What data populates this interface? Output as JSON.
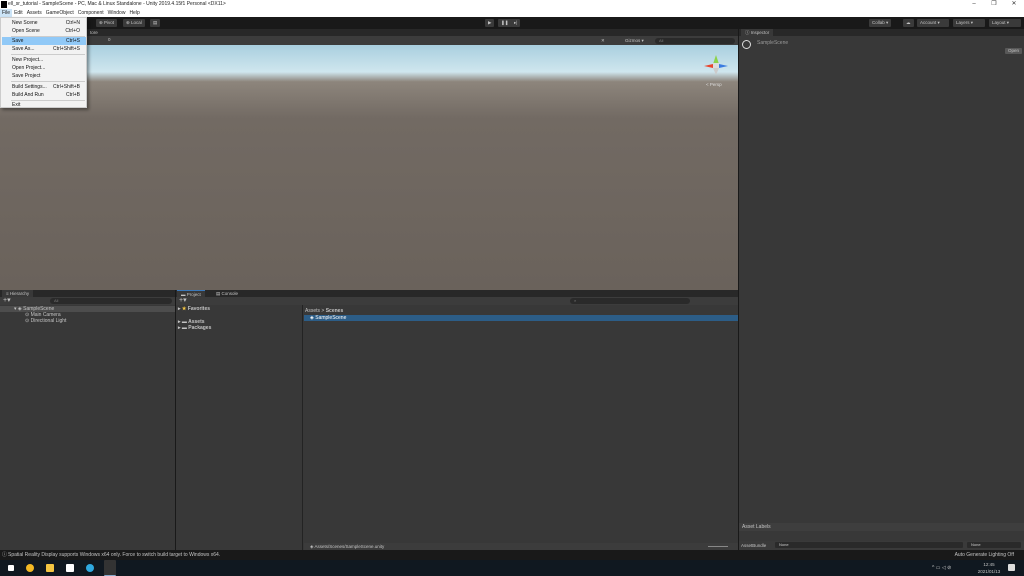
{
  "window": {
    "title": "ell_sr_tutorial - SampleScene - PC, Mac & Linux Standalone - Unity 2019.4.15f1 Personal <DX11>"
  },
  "menubar": [
    "File",
    "Edit",
    "Assets",
    "GameObject",
    "Component",
    "Window",
    "Help"
  ],
  "file_menu": [
    {
      "label": "New Scene",
      "shortcut": "Ctrl+N"
    },
    {
      "label": "Open Scene",
      "shortcut": "Ctrl+O"
    },
    {
      "label": "Save",
      "shortcut": "Ctrl+S",
      "highlighted": true
    },
    {
      "label": "Save As...",
      "shortcut": "Ctrl+Shift+S"
    },
    {
      "label": "New Project...",
      "shortcut": ""
    },
    {
      "label": "Open Project...",
      "shortcut": ""
    },
    {
      "label": "Save Project",
      "shortcut": ""
    },
    {
      "label": "Build Settings...",
      "shortcut": "Ctrl+Shift+B"
    },
    {
      "label": "Build And Run",
      "shortcut": "Ctrl+B"
    },
    {
      "label": "Exit",
      "shortcut": ""
    }
  ],
  "toolbar": {
    "pivot": "Pivot",
    "local": "Local",
    "collab": "Collab",
    "account": "Account",
    "layers": "Layers",
    "layout": "Layout"
  },
  "scene": {
    "tab_partial": "tore",
    "gizmos": "Gizmos",
    "search_placeholder": "All",
    "layer_count": "0",
    "persp": "< Persp"
  },
  "inspector": {
    "tab": "Inspector",
    "object": "SampleScene",
    "open_button": "Open",
    "asset_labels": "Asset Labels",
    "assetbundle_label": "AssetBundle",
    "assetbundle_value": "None",
    "variant_value": "None"
  },
  "hierarchy": {
    "tab": "Hierarchy",
    "search_placeholder": "All",
    "scene": "SampleScene",
    "items": [
      "Main Camera",
      "Directional Light"
    ]
  },
  "project": {
    "tabs": [
      "Project",
      "Console"
    ],
    "favorites": "Favorites",
    "folders": [
      "Assets",
      "Packages"
    ],
    "breadcrumb": [
      "Assets",
      "Scenes"
    ],
    "files": [
      "SampleScene"
    ],
    "path": "Assets/Scenes/SampleScene.unity"
  },
  "status": {
    "message": "Spatial Reality Display supports Windows x64 only. Force to switch build target to Windows x64.",
    "right": "Auto Generate Lighting Off"
  },
  "taskbar": {
    "time": "12:45",
    "date": "2021/01/13"
  },
  "colors": {
    "selection": "#2c5d87",
    "menu_highlight": "#91c9f7"
  }
}
